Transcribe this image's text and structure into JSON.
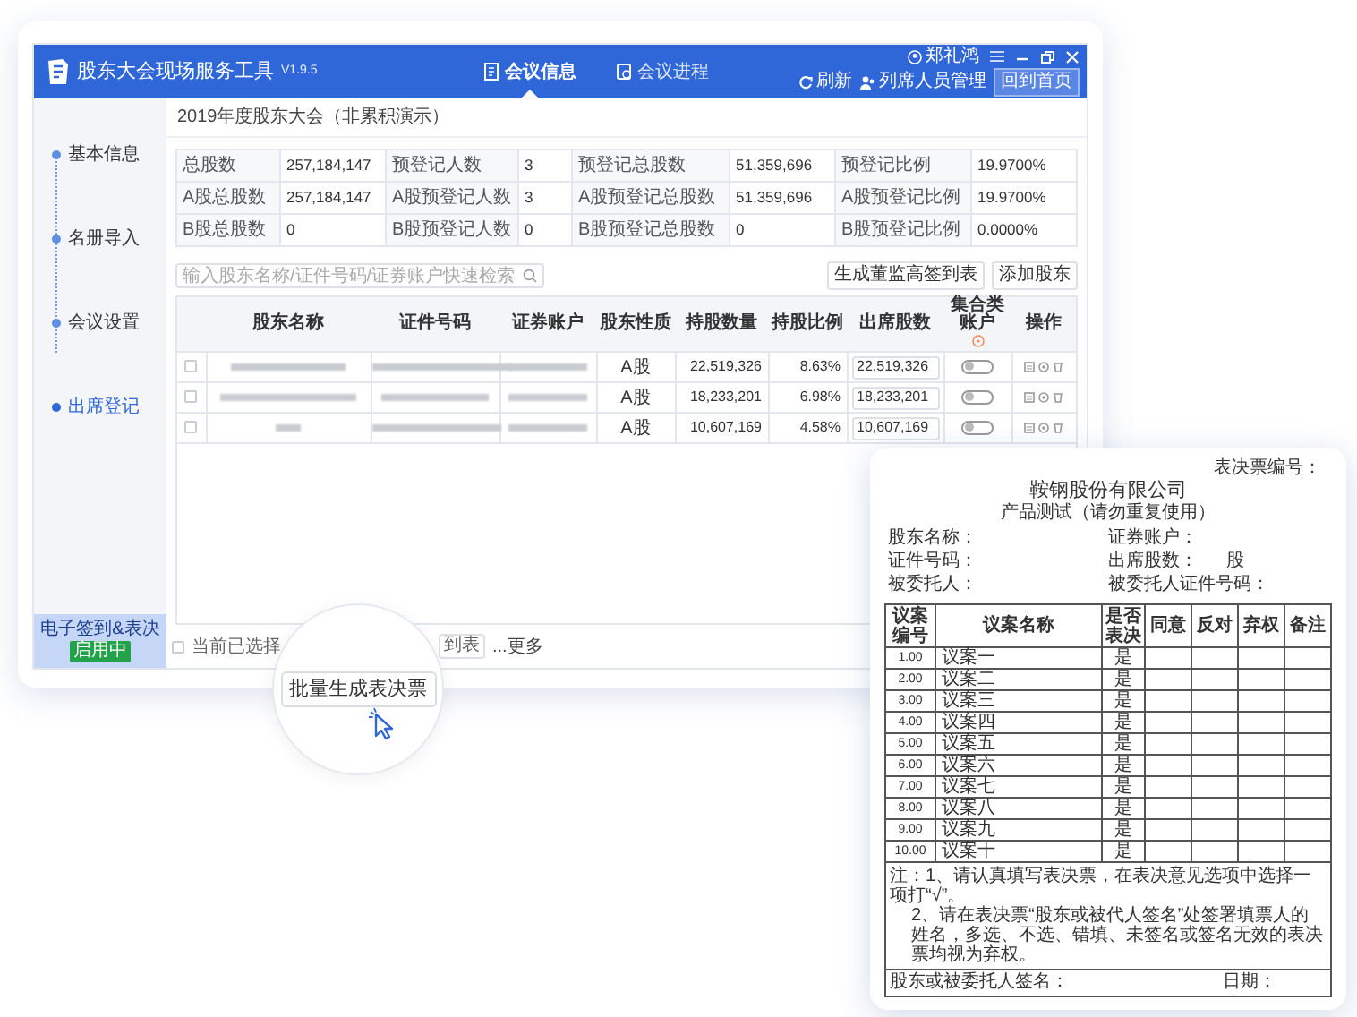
{
  "app": {
    "title": "股东大会现场服务工具",
    "version": "V1.9.5",
    "user": "郑礼鸿",
    "tabs": [
      {
        "label": "会议信息",
        "selected": true
      },
      {
        "label": "会议进程",
        "selected": false
      }
    ],
    "toolbar": [
      {
        "label": "刷新",
        "kind": "refresh"
      },
      {
        "label": "列席人员管理",
        "kind": "people"
      }
    ],
    "home_button": "回到首页"
  },
  "sidebar": {
    "items": [
      {
        "label": "基本信息",
        "selected": false
      },
      {
        "label": "名册导入",
        "selected": false
      },
      {
        "label": "会议设置",
        "selected": false
      },
      {
        "label": "出席登记",
        "selected": true
      }
    ],
    "feature": {
      "label": "电子签到&表决",
      "badge": "启用中"
    }
  },
  "meeting_title": "2019年度股东大会（非累积演示）",
  "stats": [
    [
      {
        "label": "总股数",
        "value": "257,184,147"
      },
      {
        "label": "预登记人数",
        "value": "3"
      },
      {
        "label": "预登记总股数",
        "value": "51,359,696"
      },
      {
        "label": "预登记比例",
        "value": "19.9700%"
      }
    ],
    [
      {
        "label": "A股总股数",
        "value": "257,184,147"
      },
      {
        "label": "A股预登记人数",
        "value": "3"
      },
      {
        "label": "A股预登记总股数",
        "value": "51,359,696"
      },
      {
        "label": "A股预登记比例",
        "value": "19.9700%"
      }
    ],
    [
      {
        "label": "B股总股数",
        "value": "0"
      },
      {
        "label": "B股预登记人数",
        "value": "0"
      },
      {
        "label": "B股预登记总股数",
        "value": "0"
      },
      {
        "label": "B股预登记比例",
        "value": "0.0000%"
      }
    ]
  ],
  "search": {
    "placeholder": "输入股东名称/证件号码/证券账户快速检索"
  },
  "actions": [
    "生成董监高签到表",
    "添加股东"
  ],
  "table": {
    "columns": [
      "股东名称",
      "证件号码",
      "证券账户",
      "股东性质",
      "持股数量",
      "持股比例",
      "出席股数",
      "集合类账户",
      "操作"
    ],
    "rows": [
      {
        "checked": false,
        "type": "A股",
        "shares": "22,519,326",
        "ratio": "8.63%",
        "attend": "22,519,326",
        "on": false
      },
      {
        "checked": false,
        "type": "A股",
        "shares": "18,233,201",
        "ratio": "6.98%",
        "attend": "18,233,201",
        "on": false
      },
      {
        "checked": false,
        "type": "A股",
        "shares": "10,607,169",
        "ratio": "4.58%",
        "attend": "10,607,169",
        "on": false
      }
    ]
  },
  "bulk_bar": {
    "checked": false,
    "label": "当前已选择",
    "button": "批量生成表决票",
    "partial_button": "到表",
    "more": "...更多"
  },
  "ballot": {
    "number_label": "表决票编号：",
    "company": "鞍钢股份有限公司",
    "subtitle": "产品测试（请勿重复使用）",
    "fields": [
      {
        "label": "股东名称："
      },
      {
        "label": "证券账户："
      },
      {
        "label": "证件号码："
      },
      {
        "label": "出席股数：",
        "unit": "股"
      },
      {
        "label": "被委托人："
      },
      {
        "label": "被委托人证件号码："
      }
    ],
    "columns": [
      "议案编号",
      "议案名称",
      "是否表决",
      "同意",
      "反对",
      "弃权",
      "备注"
    ],
    "rows": [
      {
        "number": "1.00",
        "name": "议案一",
        "vote": "是"
      },
      {
        "number": "2.00",
        "name": "议案二",
        "vote": "是"
      },
      {
        "number": "3.00",
        "name": "议案三",
        "vote": "是"
      },
      {
        "number": "4.00",
        "name": "议案四",
        "vote": "是"
      },
      {
        "number": "5.00",
        "name": "议案五",
        "vote": "是"
      },
      {
        "number": "6.00",
        "name": "议案六",
        "vote": "是"
      },
      {
        "number": "7.00",
        "name": "议案七",
        "vote": "是"
      },
      {
        "number": "8.00",
        "name": "议案八",
        "vote": "是"
      },
      {
        "number": "9.00",
        "name": "议案九",
        "vote": "是"
      },
      {
        "number": "10.00",
        "name": "议案十",
        "vote": "是"
      }
    ],
    "notes": [
      "注：1、请认真填写表决票，在表决意见选项中选择一项打“√”。",
      "2、请在表决票“股东或被代人签名”处签署填票人的姓名，多选、不选、错填、未签名或签名无效的表决票均视为弃权。"
    ],
    "signature": "股东或被委托人签名：",
    "date": "日期："
  }
}
